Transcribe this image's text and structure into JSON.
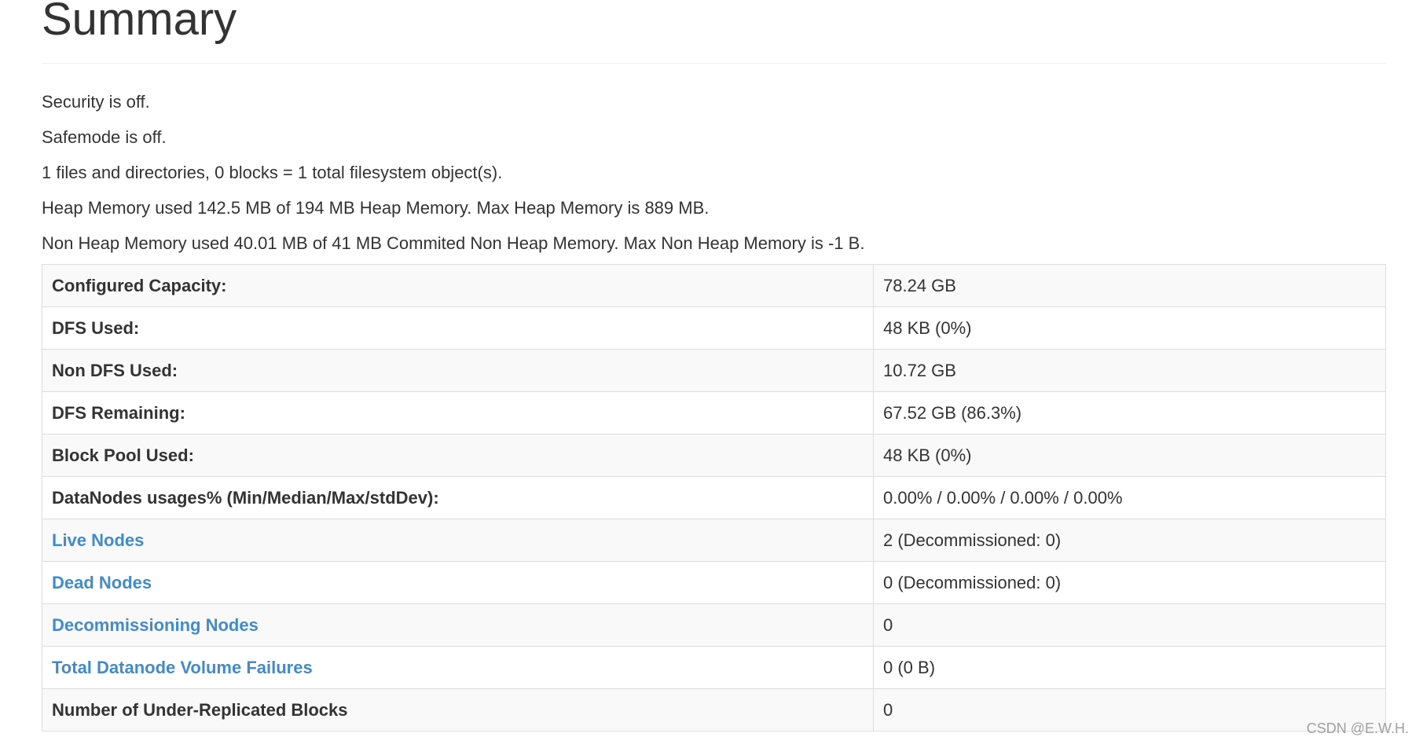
{
  "header": {
    "title": "Summary"
  },
  "status": [
    "Security is off.",
    "Safemode is off.",
    "1 files and directories, 0 blocks = 1 total filesystem object(s).",
    "Heap Memory used 142.5 MB of 194 MB Heap Memory. Max Heap Memory is 889 MB.",
    "Non Heap Memory used 40.01 MB of 41 MB Commited Non Heap Memory. Max Non Heap Memory is -1 B."
  ],
  "table": {
    "rows": [
      {
        "label": "Configured Capacity:",
        "value": "78.24 GB"
      },
      {
        "label": "DFS Used:",
        "value": "48 KB (0%)"
      },
      {
        "label": "Non DFS Used:",
        "value": "10.72 GB"
      },
      {
        "label": "DFS Remaining:",
        "value": "67.52 GB (86.3%)"
      },
      {
        "label": "Block Pool Used:",
        "value": "48 KB (0%)"
      },
      {
        "label": "DataNodes usages% (Min/Median/Max/stdDev):",
        "value": "0.00% / 0.00% / 0.00% / 0.00%"
      },
      {
        "label": "Live Nodes",
        "value": "2 (Decommissioned: 0)"
      },
      {
        "label": "Dead Nodes",
        "value": "0 (Decommissioned: 0)"
      },
      {
        "label": "Decommissioning Nodes",
        "value": "0"
      },
      {
        "label": "Total Datanode Volume Failures",
        "value": "0 (0 B)"
      },
      {
        "label": "Number of Under-Replicated Blocks",
        "value": "0"
      }
    ]
  },
  "watermark": "CSDN @E.W.H.",
  "colors": {
    "link": "#428bca",
    "text": "#333333",
    "stripe": "#f9f9f9",
    "border": "#dddddd"
  }
}
